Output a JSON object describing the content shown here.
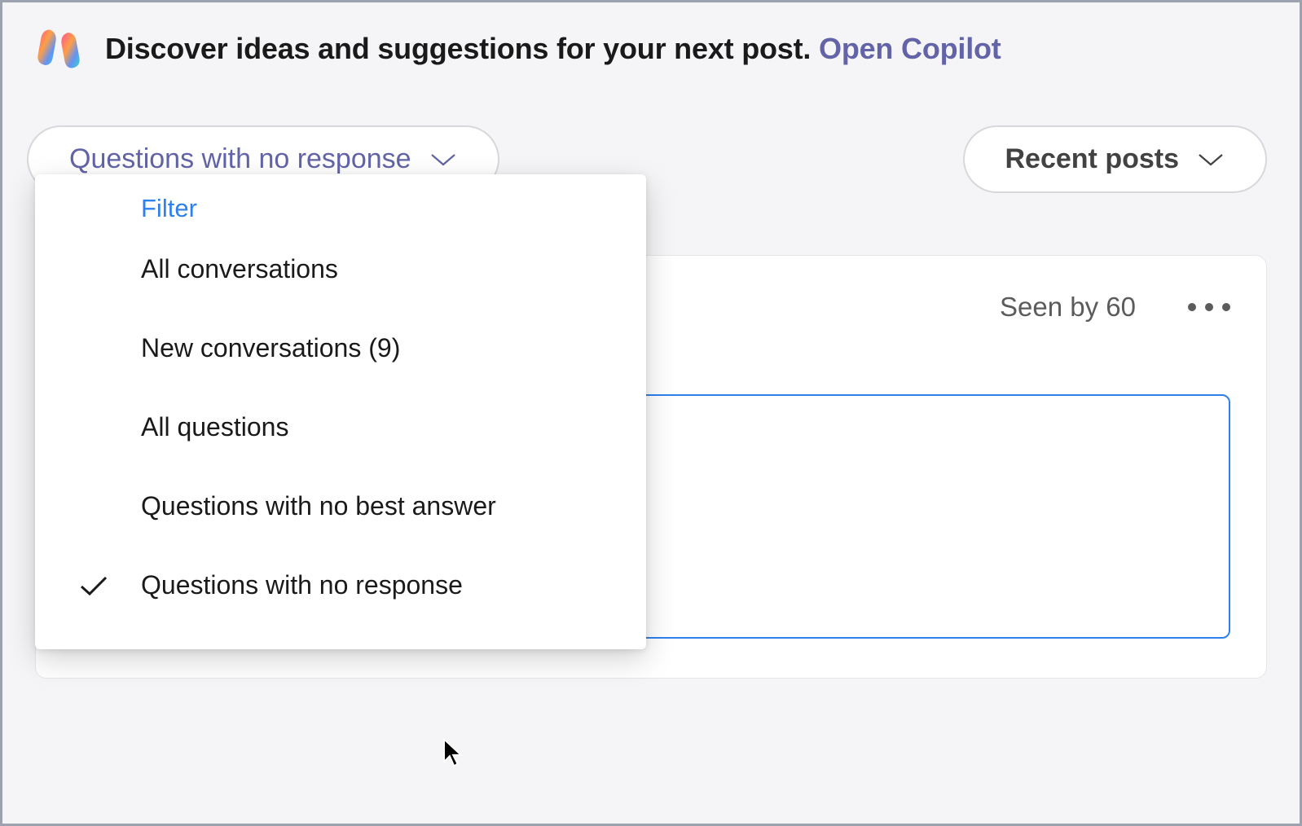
{
  "banner": {
    "text": "Discover ideas and suggestions for your next post. ",
    "link_label": "Open Copilot"
  },
  "filter": {
    "selected_label": "Questions with no response"
  },
  "sort": {
    "selected_label": "Recent posts"
  },
  "dropdown": {
    "header": "Filter",
    "items": [
      {
        "label": "All conversations",
        "checked": false
      },
      {
        "label": "New conversations (9)",
        "checked": false
      },
      {
        "label": "All questions",
        "checked": false
      },
      {
        "label": "Questions with no best answer",
        "checked": false
      },
      {
        "label": "Questions with no response",
        "checked": true
      }
    ]
  },
  "post": {
    "seen_by": "Seen by 60"
  }
}
